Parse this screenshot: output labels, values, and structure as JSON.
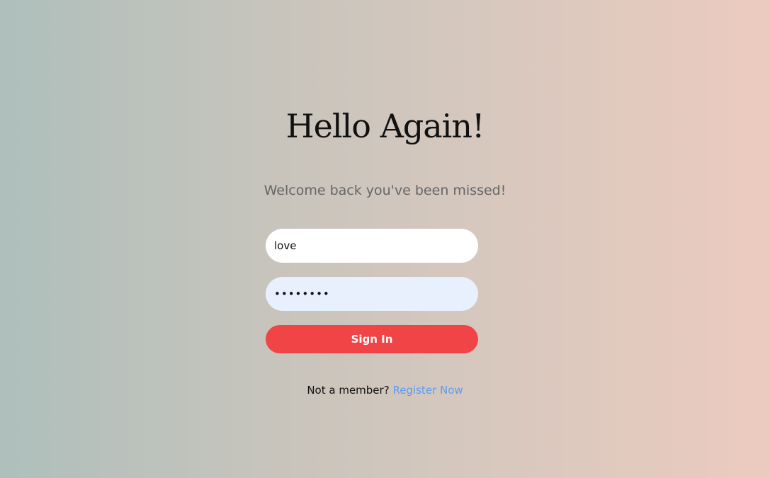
{
  "heading": "Hello Again!",
  "subheading": "Welcome back you've been missed!",
  "form": {
    "username_value": "love",
    "password_value": "••••••••",
    "signin_label": "Sign In"
  },
  "footer": {
    "prompt": "Not a member?",
    "register_link": "Register Now"
  },
  "colors": {
    "primary_button": "#f04447",
    "link": "#5b9cf0",
    "autofill_bg": "#e8f0fe"
  }
}
